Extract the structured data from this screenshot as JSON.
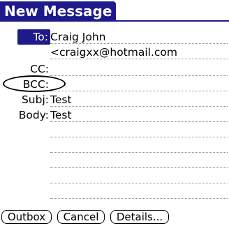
{
  "title": "New Message",
  "fields": {
    "to_label": "To:",
    "to_name": "Craig John",
    "to_email": "<craigxx@hotmail.com",
    "cc_label": "CC:",
    "bcc_label": "BCC:",
    "subj_label": "Subj:",
    "subj_value": "Test",
    "body_label": "Body:",
    "body_value": "Test"
  },
  "buttons": {
    "outbox": "Outbox",
    "cancel": "Cancel",
    "details": "Details..."
  },
  "colors": {
    "accent": "#1e1a8c"
  }
}
